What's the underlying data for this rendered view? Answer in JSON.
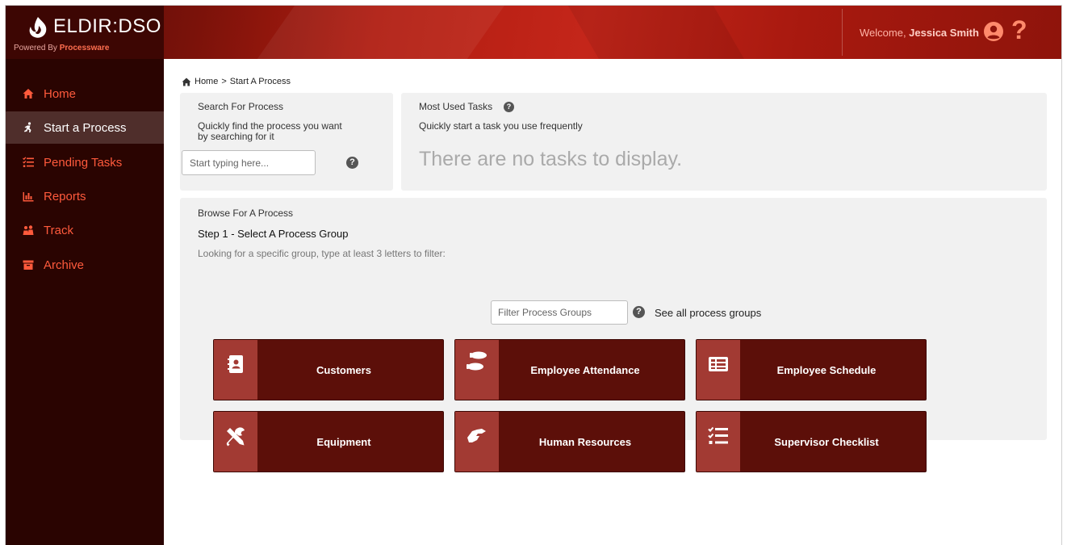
{
  "brand": {
    "name": "ELDIR:DSO",
    "powered_prefix": "Powered By ",
    "powered_name": "Processware"
  },
  "header": {
    "welcome_prefix": "Welcome, ",
    "user_name": "Jessica Smith",
    "help_symbol": "?"
  },
  "sidebar": {
    "items": [
      {
        "label": "Home",
        "icon": "home-icon",
        "active": false
      },
      {
        "label": "Start a Process",
        "icon": "running-person-icon",
        "active": true
      },
      {
        "label": "Pending Tasks",
        "icon": "checklist-icon",
        "active": false
      },
      {
        "label": "Reports",
        "icon": "bar-chart-icon",
        "active": false
      },
      {
        "label": "Track",
        "icon": "people-map-icon",
        "active": false
      },
      {
        "label": "Archive",
        "icon": "archive-box-icon",
        "active": false
      }
    ]
  },
  "breadcrumb": {
    "home": "Home",
    "separator": ">",
    "current": "Start A Process"
  },
  "search": {
    "title": "Search For Process",
    "description_line1": "Quickly find the process you want",
    "description_line2": "by searching for it",
    "placeholder": "Start typing here...",
    "help": "?"
  },
  "most_used": {
    "title": "Most Used Tasks",
    "description": "Quickly start a task you use frequently",
    "empty_message": "There are no tasks to display.",
    "help": "?"
  },
  "browse": {
    "title": "Browse For A Process",
    "step_label": "Step 1 - Select A Process Group",
    "filter_hint": "Looking for a specific group, type at least 3 letters to filter:",
    "filter_placeholder": "Filter Process Groups",
    "help": "?",
    "see_all": "See all process groups",
    "groups": [
      {
        "label": "Customers",
        "icon": "contact-book-icon"
      },
      {
        "label": "Employee Attendance",
        "icon": "footprints-icon"
      },
      {
        "label": "Employee Schedule",
        "icon": "schedule-list-icon"
      },
      {
        "label": "Equipment",
        "icon": "tools-icon"
      },
      {
        "label": "Human Resources",
        "icon": "handshake-icon"
      },
      {
        "label": "Supervisor Checklist",
        "icon": "checklist-icon"
      }
    ]
  },
  "colors": {
    "accent": "#ff5a3c",
    "tile_bg": "#5c0f09",
    "tile_icon_bg": "#a23a33",
    "sidebar_bg": "#2a0401"
  }
}
